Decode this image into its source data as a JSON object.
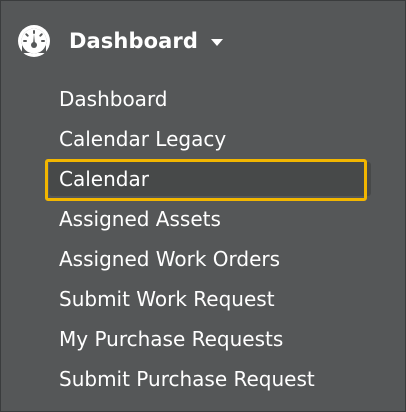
{
  "header": {
    "title": "Dashboard",
    "icon": "dashboard-gauge-icon",
    "caret_icon": "caret-down-icon"
  },
  "menu": {
    "items": [
      {
        "label": "Dashboard"
      },
      {
        "label": "Calendar Legacy"
      },
      {
        "label": "Calendar",
        "active": true
      },
      {
        "label": "Assigned Assets"
      },
      {
        "label": "Assigned Work Orders"
      },
      {
        "label": "Submit Work Request"
      },
      {
        "label": "My Purchase Requests"
      },
      {
        "label": "Submit Purchase Request"
      }
    ]
  },
  "colors": {
    "panel_background": "#555758",
    "highlight_border": "#f2b600",
    "text": "#ffffff"
  }
}
